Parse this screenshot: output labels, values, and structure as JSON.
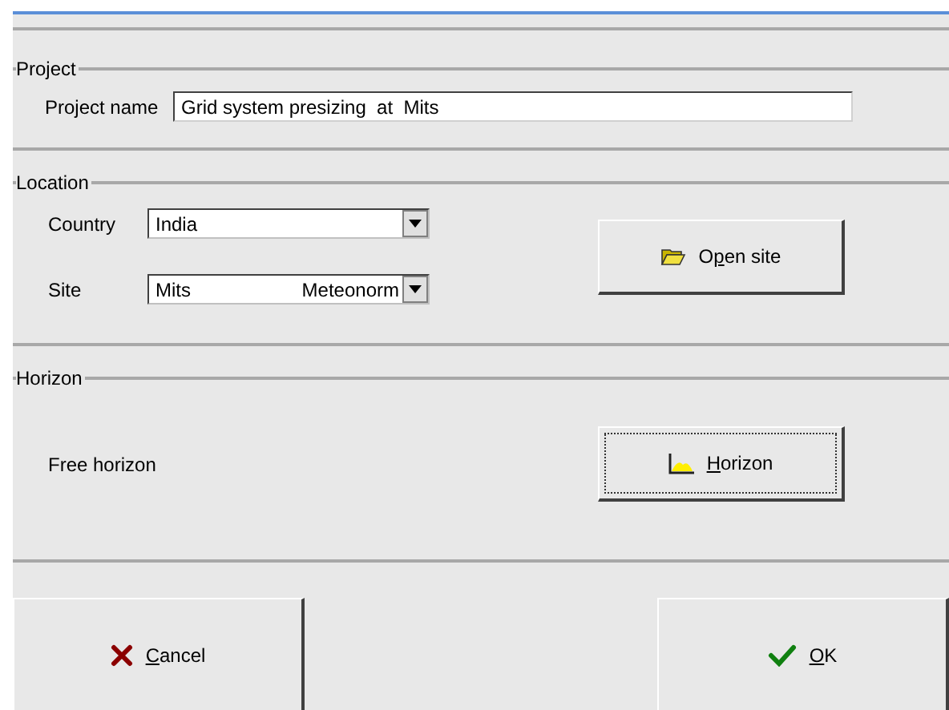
{
  "sections": [
    {
      "title": "Project",
      "kind": "project",
      "label": "Project name",
      "value": "Grid system presizing  at  Mits"
    },
    {
      "title": "Location",
      "kind": "location",
      "fields": [
        {
          "label": "Country",
          "value": "India"
        },
        {
          "label": "Site",
          "value": "Mits",
          "source": "Meteonorm"
        }
      ],
      "button": {
        "label": {
          "before": "O",
          "key": "p",
          "after": "en site"
        },
        "focused": false
      }
    },
    {
      "title": "Horizon",
      "kind": "horizon",
      "label": "Free horizon",
      "button": {
        "label": {
          "key": "H",
          "after": "orizon"
        },
        "focused": true
      }
    }
  ],
  "footer": [
    {
      "kind": "cancel",
      "label": {
        "key": "C",
        "after": "ancel"
      }
    },
    {
      "kind": "ok",
      "label": {
        "key": "O",
        "after": "K"
      }
    }
  ]
}
